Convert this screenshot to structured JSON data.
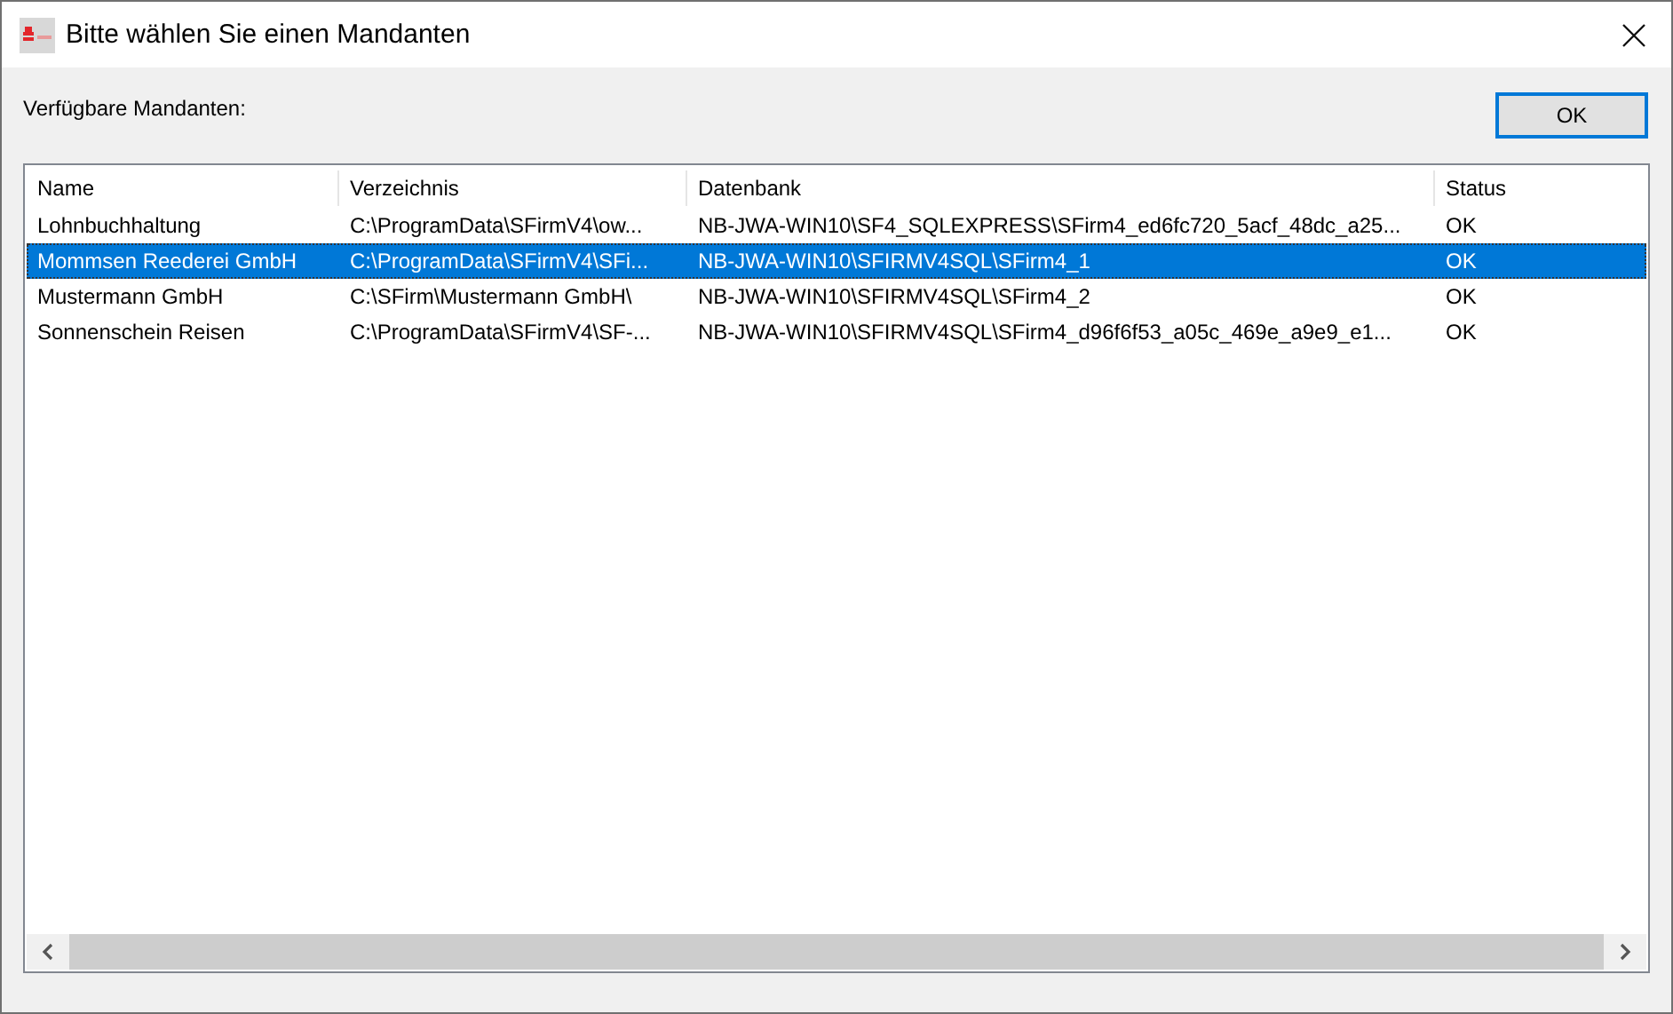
{
  "window": {
    "title": "Bitte wählen Sie einen Mandanten"
  },
  "label": "Verfügbare Mandanten:",
  "ok_button": {
    "label": "OK",
    "focused": true
  },
  "table": {
    "columns": [
      "Name",
      "Verzeichnis",
      "Datenbank",
      "Status"
    ],
    "rows": [
      {
        "cells": [
          "Lohnbuchhaltung",
          "C:\\ProgramData\\SFirmV4\\ow...",
          "NB-JWA-WIN10\\SF4_SQLEXPRESS\\SFirm4_ed6fc720_5acf_48dc_a25...",
          "OK"
        ],
        "selected": false
      },
      {
        "cells": [
          "Mommsen Reederei GmbH",
          "C:\\ProgramData\\SFirmV4\\SFi...",
          "NB-JWA-WIN10\\SFIRMV4SQL\\SFirm4_1",
          "OK"
        ],
        "selected": true
      },
      {
        "cells": [
          "Mustermann GmbH",
          "C:\\SFirm\\Mustermann GmbH\\",
          "NB-JWA-WIN10\\SFIRMV4SQL\\SFirm4_2",
          "OK"
        ],
        "selected": false
      },
      {
        "cells": [
          "Sonnenschein Reisen",
          "C:\\ProgramData\\SFirmV4\\SF-...",
          "NB-JWA-WIN10\\SFIRMV4SQL\\SFirm4_d96f6f53_a05c_469e_a9e9_e1...",
          "OK"
        ],
        "selected": false
      }
    ]
  }
}
